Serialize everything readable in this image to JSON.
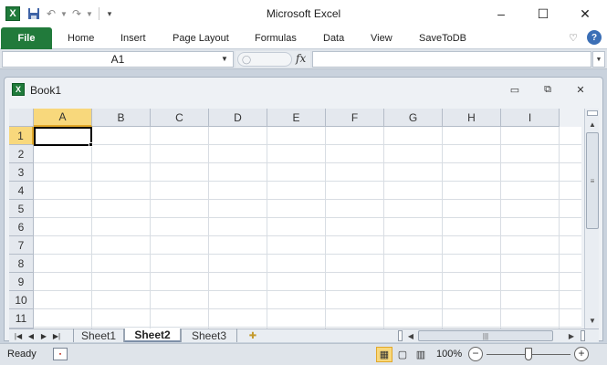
{
  "app": {
    "title": "Microsoft Excel",
    "icon": "excel-icon",
    "icon_letter": "X"
  },
  "quick_access": {
    "save": "save-icon",
    "undo": "undo-icon",
    "redo": "redo-icon",
    "customize": "customize-qat-icon"
  },
  "window_controls": {
    "minimize": "–",
    "maximize": "☐",
    "close": "✕"
  },
  "ribbon": {
    "tabs": [
      {
        "label": "File"
      },
      {
        "label": "Home"
      },
      {
        "label": "Insert"
      },
      {
        "label": "Page Layout"
      },
      {
        "label": "Formulas"
      },
      {
        "label": "Data"
      },
      {
        "label": "View"
      },
      {
        "label": "SaveToDB"
      }
    ],
    "help_q": "?"
  },
  "formula_bar": {
    "name_box": "A1",
    "fx": "fx",
    "formula": ""
  },
  "workbook": {
    "title": "Book1",
    "columns": [
      "A",
      "B",
      "C",
      "D",
      "E",
      "F",
      "G",
      "H",
      "I"
    ],
    "rows": [
      "1",
      "2",
      "3",
      "4",
      "5",
      "6",
      "7",
      "8",
      "9",
      "10",
      "11"
    ],
    "selected_cell": "A1",
    "sheets": [
      {
        "label": "Sheet1",
        "active": false
      },
      {
        "label": "Sheet2",
        "active": true
      },
      {
        "label": "Sheet3",
        "active": false
      }
    ]
  },
  "status_bar": {
    "status": "Ready",
    "zoom": "100%",
    "zoom_value": 100,
    "zoom_min": 10,
    "zoom_max": 400
  },
  "colors": {
    "accent": "#217a3b",
    "selection_header": "#f8d87c"
  }
}
